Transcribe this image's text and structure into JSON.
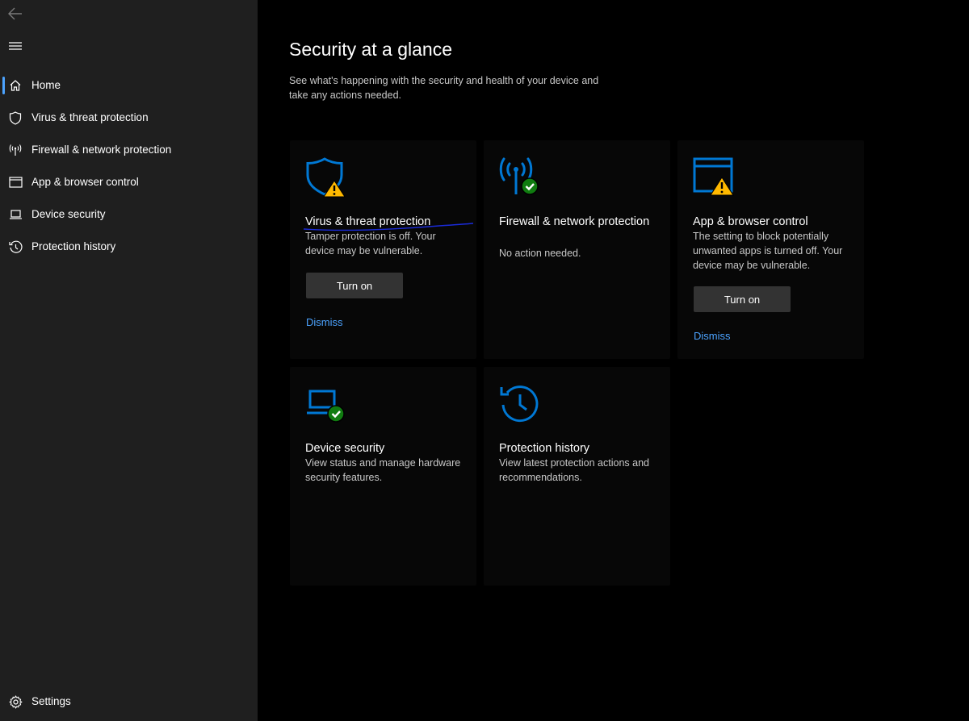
{
  "sidebar": {
    "items": [
      {
        "label": "Home",
        "icon": "home-icon",
        "active": true
      },
      {
        "label": "Virus & threat protection",
        "icon": "shield-icon"
      },
      {
        "label": "Firewall & network protection",
        "icon": "antenna-icon"
      },
      {
        "label": "App & browser control",
        "icon": "app-window-icon"
      },
      {
        "label": "Device security",
        "icon": "laptop-icon"
      },
      {
        "label": "Protection history",
        "icon": "history-icon"
      }
    ],
    "settings_label": "Settings"
  },
  "main": {
    "title": "Security at a glance",
    "subtitle": "See what's happening with the security and health of your device and take any actions needed.",
    "cards": [
      {
        "title": "Virus & threat protection",
        "description": "Tamper protection is off. Your device may be vulnerable.",
        "button_label": "Turn on",
        "link_label": "Dismiss",
        "status": "warning"
      },
      {
        "title": "Firewall & network protection",
        "description": "No action needed.",
        "status": "ok"
      },
      {
        "title": "App & browser control",
        "description": "The setting to block potentially unwanted apps is turned off. Your device may be vulnerable.",
        "button_label": "Turn on",
        "link_label": "Dismiss",
        "status": "warning"
      },
      {
        "title": "Device security",
        "description": "View status and manage hardware security features.",
        "status": "ok"
      },
      {
        "title": "Protection history",
        "description": "View latest protection actions and recommendations."
      }
    ]
  },
  "colors": {
    "accent": "#0078d4",
    "link": "#4ca3ff",
    "warning": "#ffb900",
    "ok": "#107c10",
    "sidebar_bg": "#1f1f1f",
    "main_bg": "#000000"
  }
}
